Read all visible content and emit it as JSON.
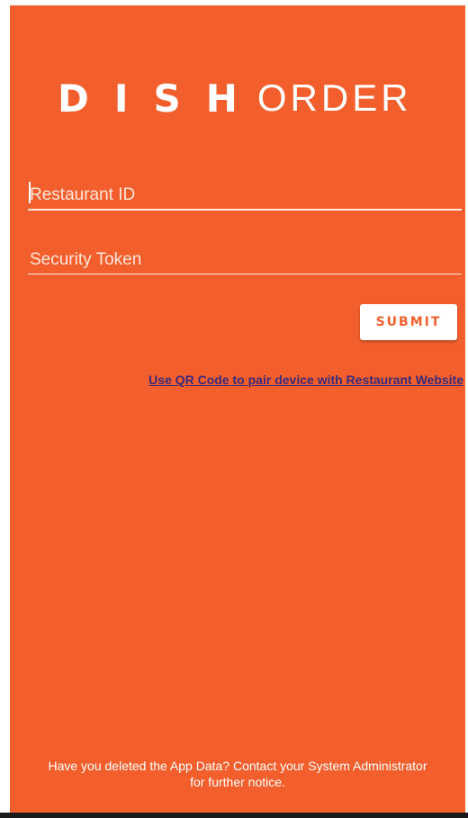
{
  "app": {
    "brand_bold": "DISH",
    "brand_light": "ORDER",
    "colors": {
      "background": "#f35f2c",
      "button_bg": "#ffffff",
      "button_text": "#f35f2c",
      "link": "#3a2a7a"
    }
  },
  "form": {
    "restaurant_id": {
      "placeholder": "Restaurant ID",
      "value": ""
    },
    "security_token": {
      "placeholder": "Security Token",
      "value": ""
    },
    "submit_label": "SUBMIT",
    "qr_link": "Use QR Code to pair device with Restaurant Website"
  },
  "footer": {
    "text": "Have you deleted the App Data? Contact your System Administrator for further notice."
  }
}
